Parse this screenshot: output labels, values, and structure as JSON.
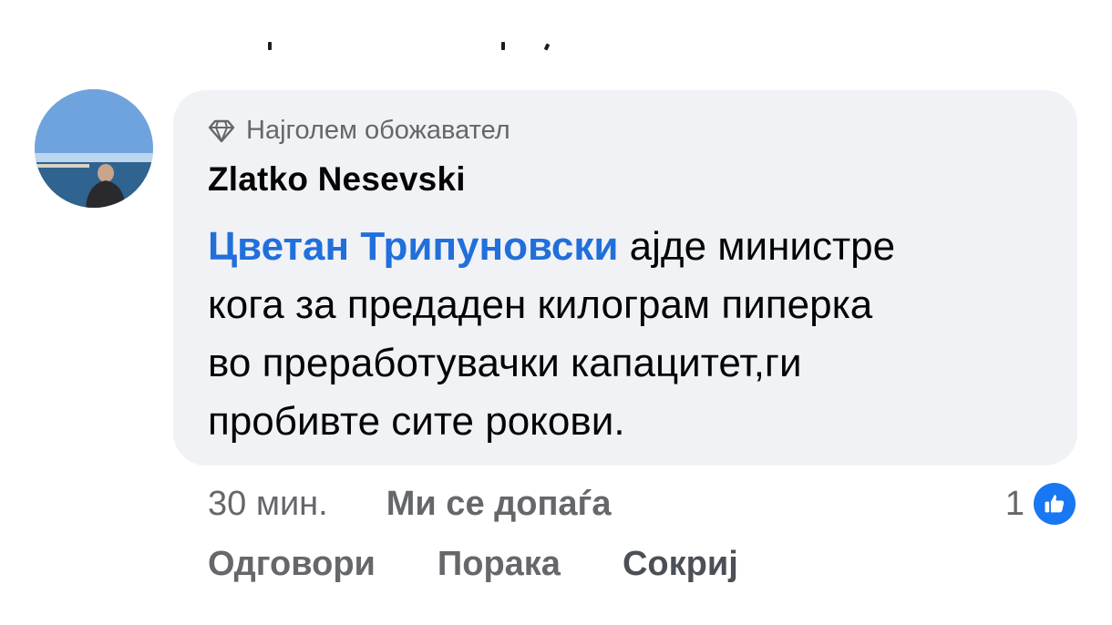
{
  "comment": {
    "badge_label": "Најголем обожавател",
    "badge_icon": "diamond-icon",
    "author": "Zlatko Nesevski",
    "mention": "Цветан Трипуновски",
    "text_line1": " ајде министре",
    "text_line2": "кога за предаден килограм пиперка",
    "text_line3": "во преработувачки капацитет,ги",
    "text_line4": "пробивте сите рокови.",
    "timestamp": "30 мин.",
    "like_action": "Ми се допаѓа",
    "reaction_count": "1",
    "reaction_icon": "thumbs-up-icon",
    "reply_action": "Одговори",
    "message_action": "Порака",
    "hide_action": "Сокриј"
  },
  "colors": {
    "bubble_bg": "#f0f2f5",
    "mention": "#216fdb",
    "secondary_text": "#65676b",
    "like_blue": "#1877f2"
  }
}
